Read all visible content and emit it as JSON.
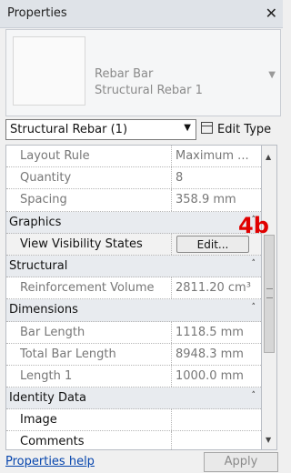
{
  "panel": {
    "title": "Properties",
    "close_glyph": "✕"
  },
  "type_selector": {
    "family": "Rebar Bar",
    "type": "Structural Rebar 1",
    "arrow": "▼"
  },
  "instance_filter": {
    "label": "Structural Rebar (1)",
    "arrow": "▼"
  },
  "edit_type": {
    "label": "Edit Type"
  },
  "rows": [
    {
      "kind": "param",
      "name": "Layout Rule",
      "value": "Maximum ..."
    },
    {
      "kind": "param",
      "name": "Quantity",
      "value": "8"
    },
    {
      "kind": "param",
      "name": "Spacing",
      "value": "358.9 mm"
    },
    {
      "kind": "group",
      "name": "Graphics"
    },
    {
      "kind": "button",
      "name": "View Visibility States",
      "button": "Edit..."
    },
    {
      "kind": "group",
      "name": "Structural"
    },
    {
      "kind": "param",
      "name": "Reinforcement Volume",
      "value": "2811.20 cm³"
    },
    {
      "kind": "group",
      "name": "Dimensions"
    },
    {
      "kind": "param",
      "name": "Bar Length",
      "value": "1118.5 mm"
    },
    {
      "kind": "param",
      "name": "Total Bar Length",
      "value": "8948.3 mm"
    },
    {
      "kind": "param",
      "name": "Length 1",
      "value": "1000.0 mm"
    },
    {
      "kind": "group",
      "name": "Identity Data"
    },
    {
      "kind": "param_active",
      "name": "Image",
      "value": ""
    },
    {
      "kind": "param_active",
      "name": "Comments",
      "value": ""
    }
  ],
  "annotation": {
    "text": "4b",
    "color": "#e00000"
  },
  "footer": {
    "help_link": "Properties help",
    "apply_label": "Apply"
  },
  "icons": {
    "collapse": "collapse-icon",
    "edit_type": "edit-type-icon"
  }
}
